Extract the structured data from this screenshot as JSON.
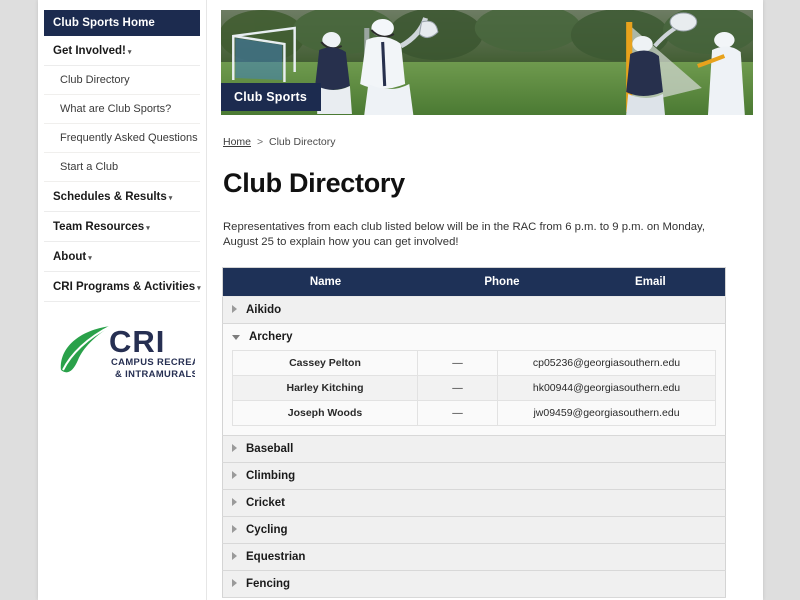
{
  "sidebar": {
    "active_item": {
      "label": "Club Sports Home",
      "name": "club-sports-home"
    },
    "groups": [
      {
        "label": "Get Involved!",
        "caret": "▾",
        "children": [
          {
            "label": "Club Directory"
          },
          {
            "label": "What are Club Sports?"
          },
          {
            "label": "Frequently Asked Questions"
          },
          {
            "label": "Start a Club"
          }
        ]
      },
      {
        "label": "Schedules & Results",
        "caret": "▾",
        "children": []
      },
      {
        "label": "Team Resources",
        "caret": "▾",
        "children": []
      },
      {
        "label": "About",
        "caret": "▾",
        "children": []
      },
      {
        "label": "CRI Programs & Activities",
        "caret": "▾",
        "children": []
      }
    ],
    "logo": {
      "acronym": "CRI",
      "line1": "CAMPUS RECREATION",
      "line2": "& INTRAMURALS",
      "leaf_color": "#2aa14a",
      "text_color": "#262f52"
    }
  },
  "hero": {
    "label": "Club Sports",
    "alt": "lacrosse-players-action-photo",
    "label_bg": "#1c2b4f"
  },
  "breadcrumb": {
    "home": "Home",
    "separator": ">",
    "current": "Club Directory"
  },
  "page": {
    "title": "Club Directory",
    "intro": "Representatives from each club listed below will be in the RAC from 6 p.m. to 9 p.m. on Monday, August 25 to explain how you can get involved!"
  },
  "directory": {
    "header_bg": "#1e3157",
    "columns": [
      "Name",
      "Phone",
      "Email"
    ],
    "clubs": [
      {
        "name": "Aikido",
        "expanded": false,
        "members": []
      },
      {
        "name": "Archery",
        "expanded": true,
        "members": [
          {
            "name": "Cassey Pelton",
            "phone": "—",
            "email": "cp05236@georgiasouthern.edu"
          },
          {
            "name": "Harley Kitching",
            "phone": "—",
            "email": "hk00944@georgiasouthern.edu"
          },
          {
            "name": "Joseph Woods",
            "phone": "—",
            "email": "jw09459@georgiasouthern.edu"
          }
        ]
      },
      {
        "name": "Baseball",
        "expanded": false,
        "members": []
      },
      {
        "name": "Climbing",
        "expanded": false,
        "members": []
      },
      {
        "name": "Cricket",
        "expanded": false,
        "members": []
      },
      {
        "name": "Cycling",
        "expanded": false,
        "members": []
      },
      {
        "name": "Equestrian",
        "expanded": false,
        "members": []
      },
      {
        "name": "Fencing",
        "expanded": false,
        "members": []
      }
    ]
  }
}
